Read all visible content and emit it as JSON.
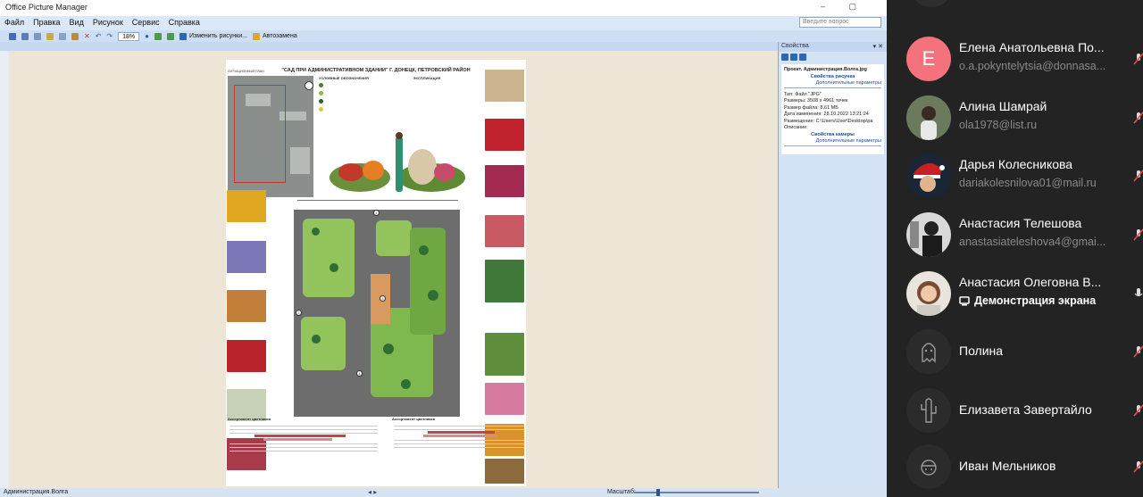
{
  "app": {
    "title": "Office Picture Manager",
    "menu": [
      "Файл",
      "Правка",
      "Вид",
      "Рисунок",
      "Сервис",
      "Справка"
    ],
    "search_placeholder": "Введите вопрос",
    "toolbar": {
      "zoom_value": "18%",
      "edit_picture_label": "Изменить рисунки...",
      "autocorrect_label": "Автозамена"
    },
    "statusbar": {
      "left_text": "Администрация.Волга",
      "zoom_label": "Масштаб:"
    },
    "poster": {
      "title": "\"САД ПРИ АДМИНИСТРАТИВНОМ ЗДАНИИ\" Г. ДОНЕЦК, ПЕТРОВСКИЙ РАЙОН",
      "aerial_label": "СИТУАЦИОННЫЙ ПЛАН",
      "legend_header": "УСЛОВНЫЕ ОБОЗНАЧЕНИЯ",
      "notes_header": "ЭКСПЛИКАЦИЯ",
      "table1_title": "Ассортимент цветников",
      "table2_title": "Ассортимент цветников"
    },
    "properties": {
      "header": "Свойства",
      "project": "Проект. Администрация.Волга.jpg",
      "picture_props_link": "Свойства рисунка",
      "extra_params_link": "Дополнительные параметры",
      "lines": [
        "Тип: Файл \"JPG\"",
        "Размеры: 3508 x 4961 точек",
        "Размер файла: 8,61 МБ",
        "Дата изменения: 28.10.2022 13:21:24",
        "Размещение: C:\\Users\\User\\Desktop\\pa",
        "Описание:"
      ],
      "camera_props_link": "Свойства камеры",
      "extra_params_link2": "Дополнительные параметры"
    }
  },
  "participants": [
    {
      "name": "Елена Анатольевна По...",
      "email": "o.a.pokyntelytsia@donnasa...",
      "avatar": "letter",
      "letter": "Е",
      "avatar_color": "#f4727c"
    },
    {
      "name": "Алина Шамрай",
      "email": "ola1978@list.ru",
      "avatar": "photo"
    },
    {
      "name": "Дарья Колесникова",
      "email": "dariakolesnilova01@mail.ru",
      "avatar": "photo"
    },
    {
      "name": "Анастасия Телешова",
      "email": "anastasiateleshova4@gmai...",
      "avatar": "photo"
    },
    {
      "name": "Анастасия Олеговна В...",
      "status": "Демонстрация экрана",
      "avatar": "photo"
    },
    {
      "name": "Полина",
      "avatar": "ghost"
    },
    {
      "name": "Елизавета Завертайло",
      "avatar": "ghost"
    },
    {
      "name": "Иван Мельников",
      "avatar": "ghost"
    }
  ]
}
